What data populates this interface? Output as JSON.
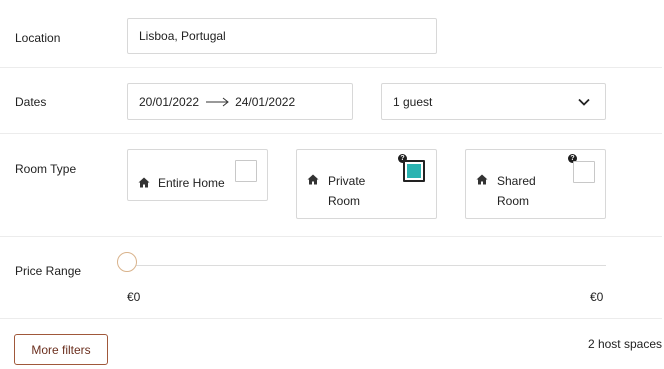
{
  "location": {
    "label": "Location",
    "value": "Lisboa, Portugal"
  },
  "dates": {
    "label": "Dates",
    "start": "20/01/2022",
    "end": "24/01/2022",
    "guests": "1 guest"
  },
  "room_type": {
    "label": "Room Type",
    "options": [
      {
        "line1": "Entire Home",
        "line2": "",
        "checked": false,
        "has_help": false
      },
      {
        "line1": "Private",
        "line2": "Room",
        "checked": true,
        "has_help": true
      },
      {
        "line1": "Shared",
        "line2": "Room",
        "checked": false,
        "has_help": true
      }
    ],
    "help_glyph": "?"
  },
  "price": {
    "label": "Price Range",
    "min": "€0",
    "max": "€0",
    "slider_value": 0
  },
  "footer": {
    "more_filters": "More filters",
    "results": "2 host spaces"
  },
  "colors": {
    "accent_teal": "#2bb3b1",
    "button_border": "#a0583a",
    "slider_thumb": "#d9b38c"
  },
  "icons": [
    "home-icon",
    "help-icon",
    "chevron-down-icon",
    "arrow-right-icon"
  ]
}
